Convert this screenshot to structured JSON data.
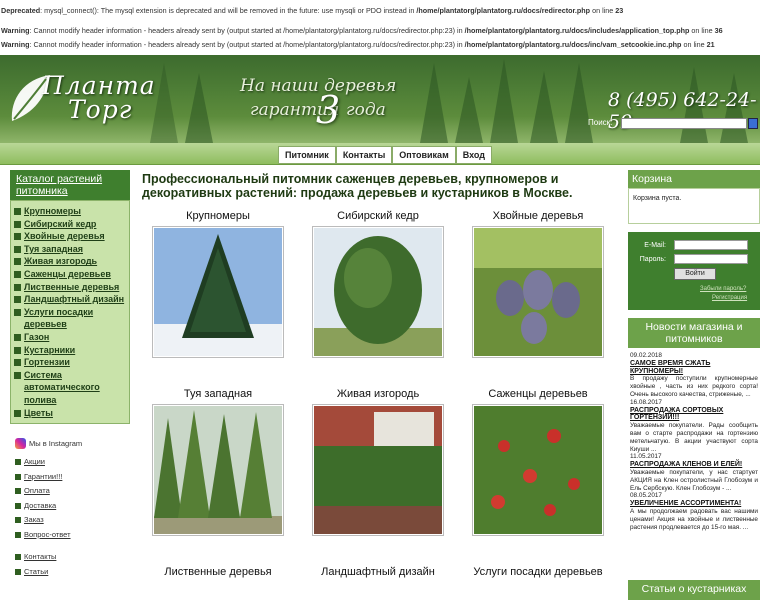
{
  "warnings": [
    {
      "label": "Deprecated",
      "text": ": mysql_connect(): The mysql extension is deprecated and will be removed in the future: use mysqli or PDO instead in ",
      "path": "/home/plantatorg/plantatorg.ru/docs/redirector.php",
      "suffix": " on line ",
      "line": "23"
    },
    {
      "label": "Warning",
      "text": ": Cannot modify header information - headers already sent by (output started at /home/plantatorg/plantatorg.ru/docs/redirector.php:23) in ",
      "path": "/home/plantatorg/plantatorg.ru/docs/includes/application_top.php",
      "suffix": " on line ",
      "line": "36"
    },
    {
      "label": "Warning",
      "text": ": Cannot modify header information - headers already sent by (output started at /home/plantatorg/plantatorg.ru/docs/redirector.php:23) in ",
      "path": "/home/plantatorg/plantatorg.ru/docs/inc/vam_setcookie.inc.php",
      "suffix": " on line ",
      "line": "21"
    }
  ],
  "header": {
    "logo_line1": "Планта",
    "logo_line2": "Торг",
    "slogan1": "На наши деревья",
    "slogan2": "гарантия",
    "slogan_num": "3",
    "slogan3": "года",
    "phone": "8 (495) 642-24-59",
    "search_label": "Поиск:"
  },
  "nav": [
    "Питомник",
    "Контакты",
    "Оптовикам",
    "Вход"
  ],
  "catalog": {
    "title": "Каталог растений питомника",
    "items": [
      "Крупномеры",
      "Сибирский кедр",
      "Хвойные деревья",
      "Туя западная",
      "Живая изгородь",
      "Саженцы деревьев",
      "Лиственные деревья",
      "Ландшафтный дизайн",
      "Услуги посадки деревьев",
      "Газон",
      "Кустарники",
      "Гортензии",
      "Система автоматического полива",
      "Цветы"
    ]
  },
  "instagram": "Мы в Instagram",
  "links1": [
    "Акции",
    "Гарантии!!!",
    "Оплата",
    "Доставка",
    "Заказ",
    "Вопрос-ответ"
  ],
  "links2": [
    "Контакты",
    "Статьи"
  ],
  "main": {
    "heading": "Профессиональный питомник саженцев деревьев, крупномеров и декоративных растений: продажа деревьев и кустарников в Москве.",
    "products": [
      "Крупномеры",
      "Сибирский кедр",
      "Хвойные деревья",
      "Туя западная",
      "Живая изгородь",
      "Саженцы деревьев",
      "Лиственные деревья",
      "Ландшафтный дизайн",
      "Услуги посадки деревьев"
    ]
  },
  "cart": {
    "title": "Корзина",
    "empty": "Корзина пуста."
  },
  "login": {
    "email_label": "E-Mail:",
    "password_label": "Пароль:",
    "button": "Войти",
    "forgot": "Забыли пароль?",
    "register": "Регистрация"
  },
  "news": {
    "title": "Новости магазина и питомников",
    "items": [
      {
        "date": "09.02.2018",
        "title": "САМОЕ ВРЕМЯ СЖАТЬ КРУПНОМЕРЫ!",
        "text": "В продажу поступили крупномерные хвойные , часть из них редкого сорта! Очень высокого качества, стриженые, ..."
      },
      {
        "date": "16.08.2017",
        "title": "РАСПРОДАЖА СОРТОВЫХ ГОРТЕНЗИЙ!!!",
        "text": "Уважаемые покупатели. Рады сообщить вам о старте распродажи на гортензию метельчатую. В акции участвуют сорта Киуши ..."
      },
      {
        "date": "11.05.2017",
        "title": "РАСПРОДАЖА КЛЕНОВ И ЕЛЕЙ!",
        "text": "Уважаемые покупатели, у нас стартует АКЦИЯ на Клен остролистный Глобозум и Ель Сербскую. Клен Глобозум - ..."
      },
      {
        "date": "08.05.2017",
        "title": "УВЕЛИЧЕНИЕ АССОРТИМЕНТА!",
        "text": "А мы продолжаем радовать вас нашими ценами! Акция на хвойные и лиственные растения продлевается до 15-го мая. ..."
      }
    ]
  },
  "articles_title": "Статьи о кустарниках"
}
